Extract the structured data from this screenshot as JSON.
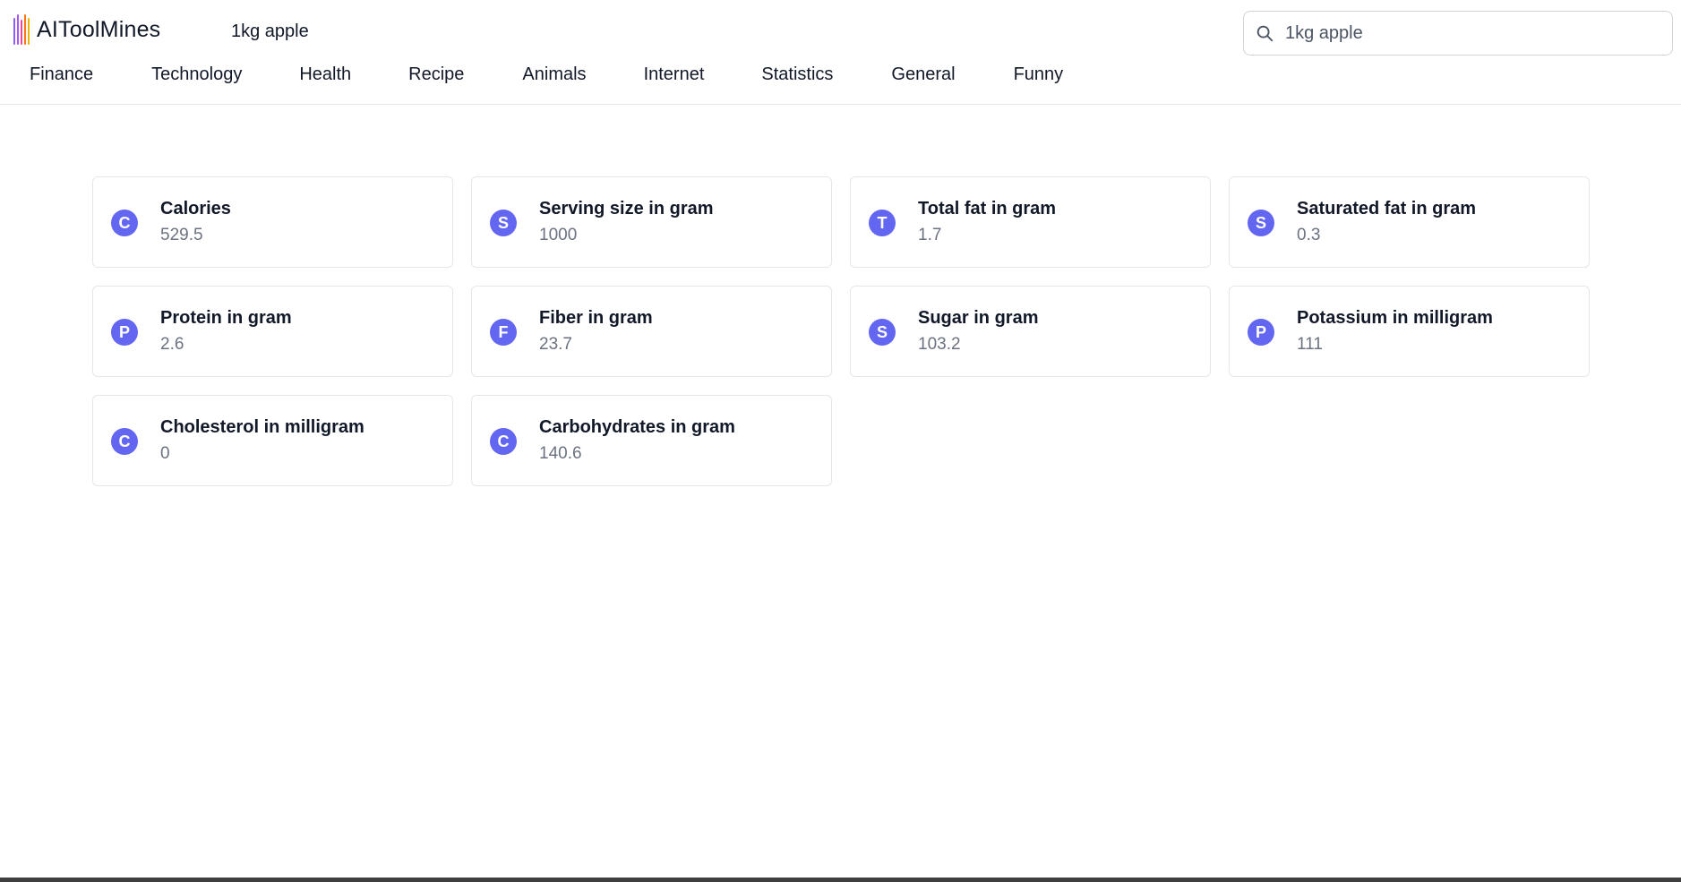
{
  "brand": {
    "name": "AIToolMines",
    "bar_colors": [
      "#8b5cf6",
      "#a855f7",
      "#ec4899",
      "#f97316",
      "#eab308"
    ]
  },
  "query_title": "1kg apple",
  "search": {
    "value": "1kg apple",
    "icon": "search-icon"
  },
  "nav": {
    "items": [
      {
        "label": "Finance"
      },
      {
        "label": "Technology"
      },
      {
        "label": "Health"
      },
      {
        "label": "Recipe"
      },
      {
        "label": "Animals"
      },
      {
        "label": "Internet"
      },
      {
        "label": "Statistics"
      },
      {
        "label": "General"
      },
      {
        "label": "Funny"
      }
    ]
  },
  "nutrition": {
    "accent_color": "#6366f1",
    "cards": [
      {
        "initial": "C",
        "label": "Calories",
        "value": "529.5"
      },
      {
        "initial": "S",
        "label": "Serving size in gram",
        "value": "1000"
      },
      {
        "initial": "T",
        "label": "Total fat in gram",
        "value": "1.7"
      },
      {
        "initial": "S",
        "label": "Saturated fat in gram",
        "value": "0.3"
      },
      {
        "initial": "P",
        "label": "Protein in gram",
        "value": "2.6"
      },
      {
        "initial": "F",
        "label": "Fiber in gram",
        "value": "23.7"
      },
      {
        "initial": "S",
        "label": "Sugar in gram",
        "value": "103.2"
      },
      {
        "initial": "P",
        "label": "Potassium in milligram",
        "value": "111"
      },
      {
        "initial": "C",
        "label": "Cholesterol in milligram",
        "value": "0"
      },
      {
        "initial": "C",
        "label": "Carbohydrates in gram",
        "value": "140.6"
      }
    ]
  }
}
